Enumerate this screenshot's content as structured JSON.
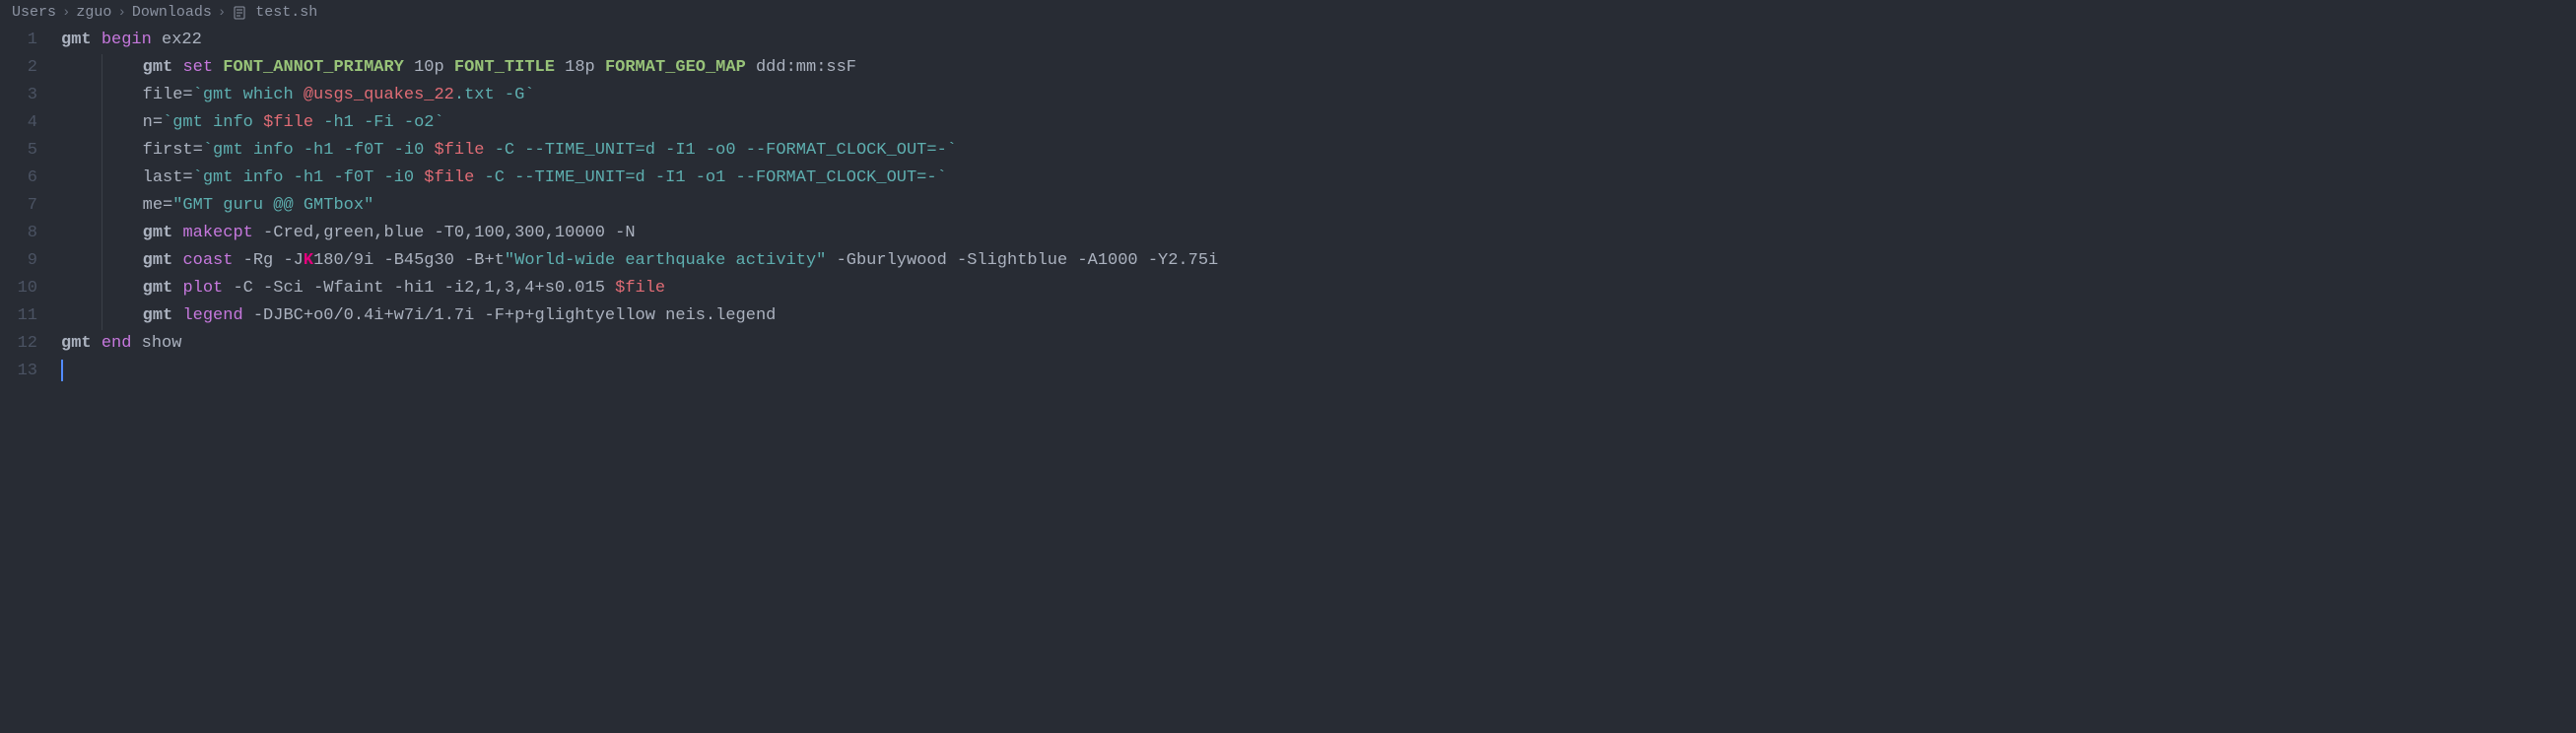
{
  "breadcrumb": {
    "parts": [
      "Users",
      "zguo",
      "Downloads",
      "test.sh"
    ]
  },
  "lines": [
    {
      "num": "1",
      "indent": 0,
      "tokens": [
        {
          "t": "gmt",
          "c": "c-keyword-bold"
        },
        {
          "t": " ",
          "c": "c-default"
        },
        {
          "t": "begin",
          "c": "c-keyword"
        },
        {
          "t": " ",
          "c": "c-default"
        },
        {
          "t": "ex22",
          "c": "c-default"
        }
      ]
    },
    {
      "num": "2",
      "indent": 1,
      "tokens": [
        {
          "t": "gmt",
          "c": "c-keyword-bold"
        },
        {
          "t": " ",
          "c": "c-default"
        },
        {
          "t": "set",
          "c": "c-keyword"
        },
        {
          "t": " ",
          "c": "c-default"
        },
        {
          "t": "FONT_ANNOT_PRIMARY",
          "c": "c-green-bold"
        },
        {
          "t": " 10p ",
          "c": "c-default"
        },
        {
          "t": "FONT_TITLE",
          "c": "c-green-bold"
        },
        {
          "t": " 18p ",
          "c": "c-default"
        },
        {
          "t": "FORMAT_GEO_MAP",
          "c": "c-green-bold"
        },
        {
          "t": " ddd:mm:ssF",
          "c": "c-default"
        }
      ]
    },
    {
      "num": "3",
      "indent": 1,
      "tokens": [
        {
          "t": "file=",
          "c": "c-default"
        },
        {
          "t": "`gmt which ",
          "c": "c-string-teal"
        },
        {
          "t": "@usgs_quakes_22",
          "c": "c-pink"
        },
        {
          "t": ".txt -G`",
          "c": "c-string-teal"
        }
      ]
    },
    {
      "num": "4",
      "indent": 1,
      "tokens": [
        {
          "t": "n=",
          "c": "c-default"
        },
        {
          "t": "`gmt info ",
          "c": "c-string-teal"
        },
        {
          "t": "$file",
          "c": "c-pink"
        },
        {
          "t": " -h1 -Fi -o2`",
          "c": "c-string-teal"
        }
      ]
    },
    {
      "num": "5",
      "indent": 1,
      "tokens": [
        {
          "t": "first=",
          "c": "c-default"
        },
        {
          "t": "`gmt info -h1 -f0T -i0 ",
          "c": "c-string-teal"
        },
        {
          "t": "$file",
          "c": "c-pink"
        },
        {
          "t": " -C --TIME_UNIT=d -I1 -o0 --FORMAT_CLOCK_OUT=-`",
          "c": "c-string-teal"
        }
      ]
    },
    {
      "num": "6",
      "indent": 1,
      "tokens": [
        {
          "t": "last=",
          "c": "c-default"
        },
        {
          "t": "`gmt info -h1 -f0T -i0 ",
          "c": "c-string-teal"
        },
        {
          "t": "$file",
          "c": "c-pink"
        },
        {
          "t": " -C --TIME_UNIT=d -I1 -o1 --FORMAT_CLOCK_OUT=-`",
          "c": "c-string-teal"
        }
      ]
    },
    {
      "num": "7",
      "indent": 1,
      "tokens": [
        {
          "t": "me=",
          "c": "c-default"
        },
        {
          "t": "\"GMT guru @@ GMTbox\"",
          "c": "c-string-teal"
        }
      ]
    },
    {
      "num": "8",
      "indent": 1,
      "tokens": [
        {
          "t": "gmt",
          "c": "c-keyword-bold"
        },
        {
          "t": " ",
          "c": "c-default"
        },
        {
          "t": "makecpt",
          "c": "c-keyword"
        },
        {
          "t": " -Cred,green,blue -T0,100,300,10000 -N",
          "c": "c-default"
        }
      ]
    },
    {
      "num": "9",
      "indent": 1,
      "tokens": [
        {
          "t": "gmt",
          "c": "c-keyword-bold"
        },
        {
          "t": " ",
          "c": "c-default"
        },
        {
          "t": "coast",
          "c": "c-keyword"
        },
        {
          "t": " -Rg -J",
          "c": "c-default"
        },
        {
          "t": "K",
          "c": "c-magenta"
        },
        {
          "t": "180/9i -B45g30 -B+t",
          "c": "c-default"
        },
        {
          "t": "\"World-wide earthquake activity\"",
          "c": "c-string-teal"
        },
        {
          "t": " -Gburlywood -Slightblue -A1000 -Y2.75i",
          "c": "c-default"
        }
      ]
    },
    {
      "num": "10",
      "indent": 1,
      "tokens": [
        {
          "t": "gmt",
          "c": "c-keyword-bold"
        },
        {
          "t": " ",
          "c": "c-default"
        },
        {
          "t": "plot",
          "c": "c-keyword"
        },
        {
          "t": " -C -Sci -Wfaint -hi1 -i2,1,3,4+s0.015 ",
          "c": "c-default"
        },
        {
          "t": "$file",
          "c": "c-pink"
        }
      ]
    },
    {
      "num": "11",
      "indent": 1,
      "tokens": [
        {
          "t": "gmt",
          "c": "c-keyword-bold"
        },
        {
          "t": " ",
          "c": "c-default"
        },
        {
          "t": "legend",
          "c": "c-keyword"
        },
        {
          "t": " -DJBC+o0/0.4i+w7i/1.7i -F+p+glightyellow neis.legend",
          "c": "c-default"
        }
      ]
    },
    {
      "num": "12",
      "indent": 0,
      "tokens": [
        {
          "t": "gmt",
          "c": "c-keyword-bold"
        },
        {
          "t": " ",
          "c": "c-default"
        },
        {
          "t": "end",
          "c": "c-keyword"
        },
        {
          "t": " show",
          "c": "c-default"
        }
      ]
    },
    {
      "num": "13",
      "indent": 0,
      "tokens": []
    }
  ]
}
